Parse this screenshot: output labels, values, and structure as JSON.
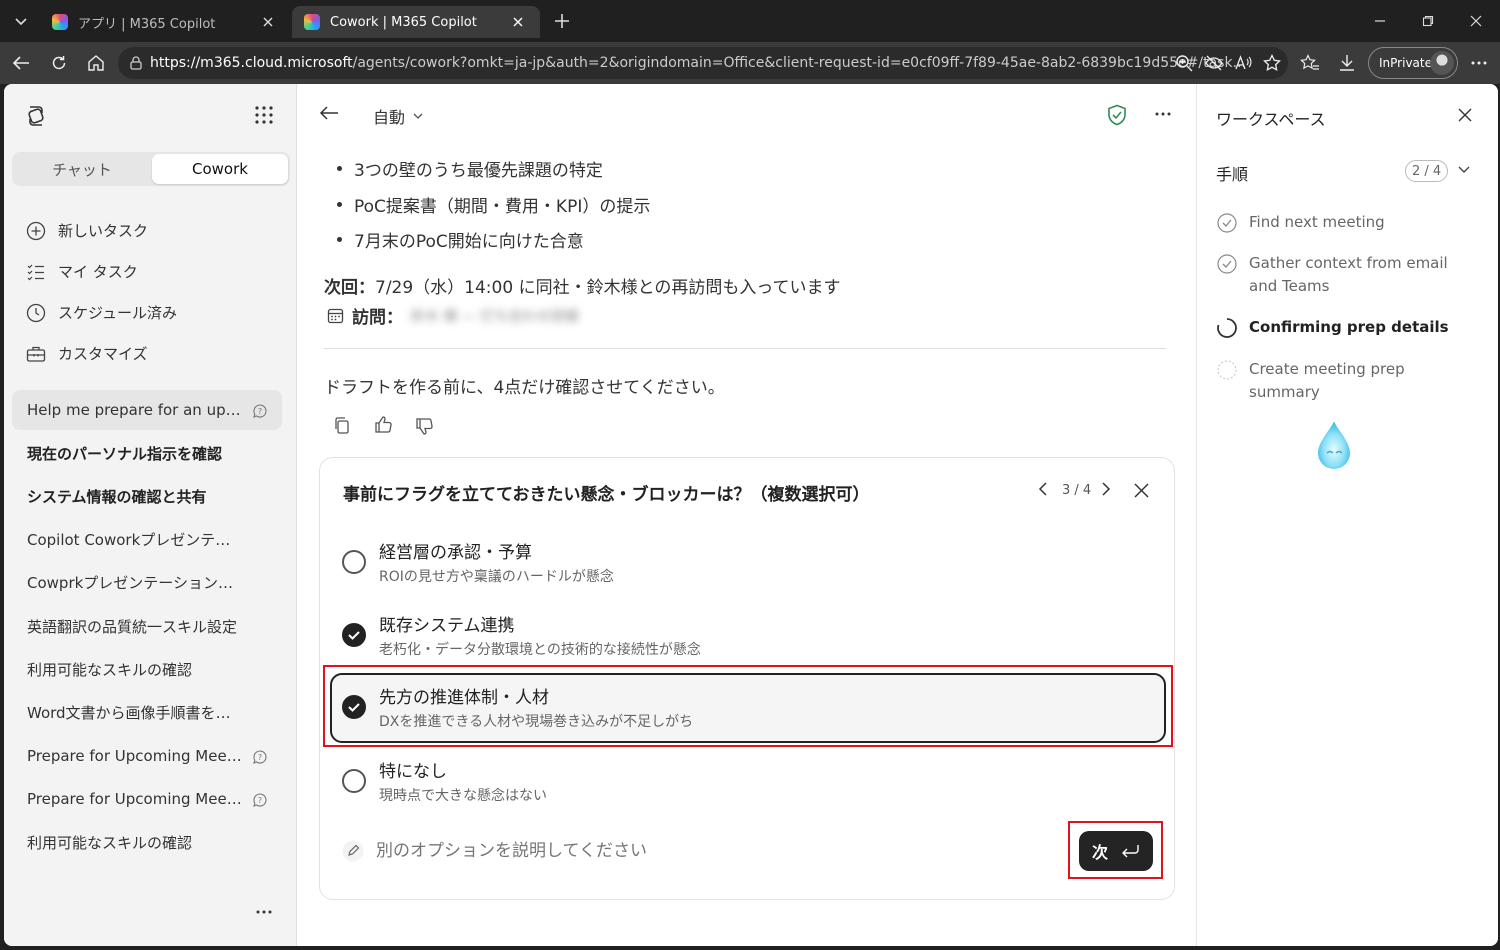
{
  "browser": {
    "tabs": [
      {
        "title": "アプリ | M365 Copilot",
        "active": false
      },
      {
        "title": "Cowork | M365 Copilot",
        "active": true
      }
    ],
    "url_host": "https://m365.cloud.microsoft",
    "url_rest": "/agents/cowork?omkt=ja-jp&auth=2&origindomain=Office&client-request-id=e0cf09ff-7f89-45ae-8ab2-6839bc19d55e#/task...",
    "inprivate_label": "InPrivate"
  },
  "sidebar": {
    "tabs": [
      {
        "label": "チャット",
        "active": false
      },
      {
        "label": "Cowork",
        "active": true
      }
    ],
    "nav": [
      {
        "label": "新しいタスク",
        "icon": "plus-circle-icon"
      },
      {
        "label": "マイ タスク",
        "icon": "task-list-icon"
      },
      {
        "label": "スケジュール済み",
        "icon": "clock-icon"
      },
      {
        "label": "カスタマイズ",
        "icon": "toolbox-icon"
      }
    ],
    "history": [
      {
        "label": "Help me prepare for an upc...",
        "selected": true,
        "bold": false,
        "has_question": true
      },
      {
        "label": "現在のパーソナル指示を確認",
        "selected": false,
        "bold": true,
        "has_question": false
      },
      {
        "label": "システム情報の確認と共有",
        "selected": false,
        "bold": true,
        "has_question": false
      },
      {
        "label": "Copilot Coworkプレゼンテーシ...",
        "selected": false,
        "bold": false,
        "has_question": false
      },
      {
        "label": "Cowprkプレゼンテーション資料...",
        "selected": false,
        "bold": false,
        "has_question": false
      },
      {
        "label": "英語翻訳の品質統一スキル設定",
        "selected": false,
        "bold": false,
        "has_question": false
      },
      {
        "label": "利用可能なスキルの確認",
        "selected": false,
        "bold": false,
        "has_question": false
      },
      {
        "label": "Word文書から画像手順書を作成",
        "selected": false,
        "bold": false,
        "has_question": false
      },
      {
        "label": "Prepare for Upcoming Meet...",
        "selected": false,
        "bold": false,
        "has_question": true
      },
      {
        "label": "Prepare for Upcoming Meet...",
        "selected": false,
        "bold": false,
        "has_question": true
      },
      {
        "label": "利用可能なスキルの確認",
        "selected": false,
        "bold": false,
        "has_question": false
      }
    ]
  },
  "main": {
    "mode_label": "自動",
    "bullets": [
      "3つの壁のうち最優先課題の特定",
      "PoC提案書（期間・費用・KPI）の提示",
      "7月末のPoC開始に向けた合意"
    ],
    "next_prefix": "次回：",
    "next_text": "7/29（水）14:00 に同社・鈴木様との再訪問も入っています",
    "visit_prefix": "訪問：",
    "visit_blurred": "鈴木 様 — 打ち合わせ詳細",
    "confirm_text": "ドラフトを作る前に、4点だけ確認させてください。",
    "question": {
      "title": "事前にフラグを立てておきたい懸念・ブロッカーは？（複数選択可）",
      "pager": "3 / 4",
      "options": [
        {
          "title": "経営層の承認・予算",
          "subtitle": "ROIの見せ方や稟議のハードルが懸念",
          "checked": false,
          "highlighted": false
        },
        {
          "title": "既存システム連携",
          "subtitle": "老朽化・データ分散環境との技術的な接続性が懸念",
          "checked": true,
          "highlighted": false
        },
        {
          "title": "先方の推進体制・人材",
          "subtitle": "DXを推進できる人材や現場巻き込みが不足しがち",
          "checked": true,
          "highlighted": true
        },
        {
          "title": "特になし",
          "subtitle": "現時点で大きな懸念はない",
          "checked": false,
          "highlighted": false
        }
      ],
      "other_placeholder": "別のオプションを説明してください",
      "next_label": "次"
    }
  },
  "workspace": {
    "title": "ワークスペース",
    "steps_label": "手順",
    "steps_count": "2 / 4",
    "steps": [
      {
        "label": "Find next meeting",
        "status": "done"
      },
      {
        "label": "Gather context from email and Teams",
        "status": "done"
      },
      {
        "label": "Confirming prep details",
        "status": "in-progress"
      },
      {
        "label": "Create meeting prep summary",
        "status": "pending"
      }
    ]
  },
  "colors": {
    "highlight": "#e0121b",
    "accent_green": "#2e8b57"
  }
}
